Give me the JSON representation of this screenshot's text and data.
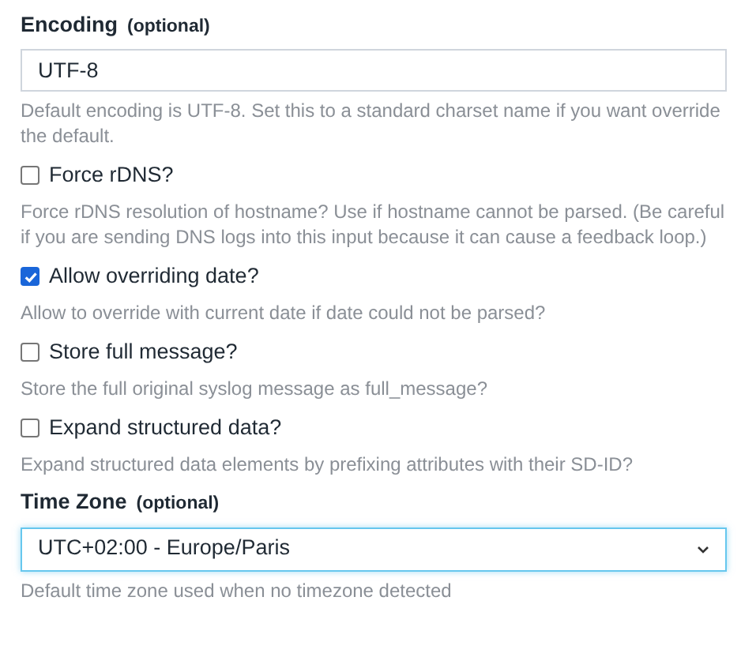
{
  "fields": [
    {
      "kind": "text",
      "label": "Encoding",
      "optional": "(optional)",
      "value": "UTF-8",
      "help": "Default encoding is UTF-8. Set this to a standard charset name if you want override the default."
    },
    {
      "kind": "checkbox",
      "label": "Force rDNS?",
      "checked": false,
      "help": "Force rDNS resolution of hostname? Use if hostname cannot be parsed. (Be careful if you are sending DNS logs into this input because it can cause a feedback loop.)"
    },
    {
      "kind": "checkbox",
      "label": "Allow overriding date?",
      "checked": true,
      "help": "Allow to override with current date if date could not be parsed?"
    },
    {
      "kind": "checkbox",
      "label": "Store full message?",
      "checked": false,
      "help": "Store the full original syslog message as full_message?"
    },
    {
      "kind": "checkbox",
      "label": "Expand structured data?",
      "checked": false,
      "help": "Expand structured data elements by prefixing attributes with their SD-ID?"
    },
    {
      "kind": "select",
      "label": "Time Zone",
      "optional": "(optional)",
      "value": "UTC+02:00 - Europe/Paris",
      "focused": true,
      "help": "Default time zone used when no timezone detected"
    }
  ]
}
